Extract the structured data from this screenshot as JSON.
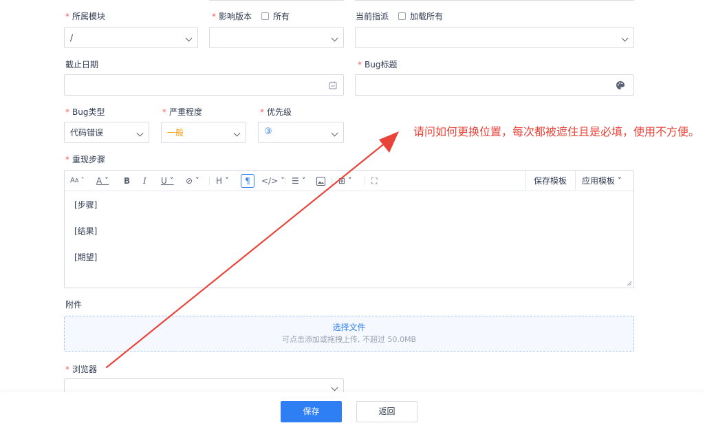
{
  "form": {
    "module": {
      "label": "所属模块",
      "value": "/"
    },
    "version": {
      "label": "影响版本",
      "checkbox_label": "所有",
      "value": ""
    },
    "assignee": {
      "label": "当前指派",
      "checkbox_label": "加载所有",
      "value": ""
    },
    "deadline": {
      "label": "截止日期",
      "value": ""
    },
    "bug_title": {
      "label": "Bug标题",
      "value": ""
    },
    "bug_type": {
      "label": "Bug类型",
      "value": "代码错误"
    },
    "severity": {
      "label": "严重程度",
      "value": "一般",
      "color": "#ff9f0a"
    },
    "priority": {
      "label": "优先级",
      "value": "③",
      "color": "#2e7ff4"
    },
    "steps": {
      "label": "重现步骤",
      "toolbar": {
        "font_size": "A",
        "heading": "H",
        "save_template": "保存模板",
        "apply_template": "应用模板"
      },
      "lines": [
        "[步骤]",
        "[结果]",
        "[期望]"
      ]
    },
    "attachment": {
      "label": "附件",
      "select_file": "选择文件",
      "hint": "可点击添加或拖拽上传, 不超过 50.0MB"
    },
    "browser": {
      "label": "浏览器",
      "value": ""
    }
  },
  "actions": {
    "save_label": "保存",
    "back_label": "返回"
  },
  "annotation": {
    "text": "请问如何更换位置，每次都被遮住且是必填，使用不方便。",
    "color": "#e8443a"
  },
  "colors": {
    "required": "#ff5d5d",
    "primary": "#2e7ff4",
    "border": "#d8dbe6"
  }
}
